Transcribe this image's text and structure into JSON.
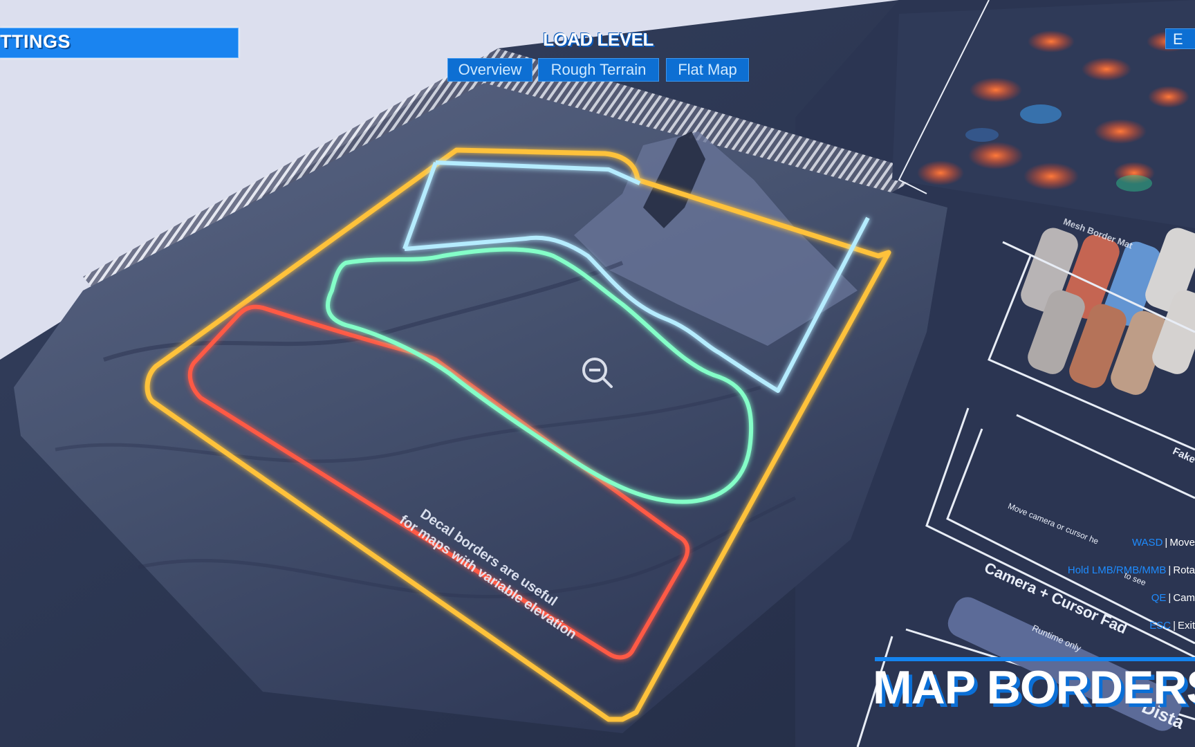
{
  "settings_menu": {
    "label": "TTINGS"
  },
  "load_level": {
    "title": "LOAD LEVEL",
    "buttons": [
      {
        "label": "Overview"
      },
      {
        "label": "Rough Terrain"
      },
      {
        "label": "Flat Map"
      }
    ]
  },
  "exit_button": {
    "label": "E"
  },
  "terrain": {
    "caption_line1": "Decal borders are useful",
    "caption_line2": "for maps with variable elevation",
    "borders": [
      {
        "name": "orange-border",
        "color": "#ffb020"
      },
      {
        "name": "red-border",
        "color": "#ff5540"
      },
      {
        "name": "green-border",
        "color": "#7dffc0"
      },
      {
        "name": "blue-border",
        "color": "#a9e6ff"
      }
    ]
  },
  "floor_labels": {
    "mesh_border": "Mesh Border Mat",
    "fake": "Fake",
    "move_hint": "Move camera or cursor he",
    "see_hint": "to see",
    "camera_cursor": "Camera + Cursor Fad",
    "runtime": "Runtime only",
    "distance": "Dista"
  },
  "controls": [
    {
      "key": "WASD",
      "action": "Move"
    },
    {
      "key": "Hold LMB/RMB/MMB",
      "action": "Rota"
    },
    {
      "key": "QE",
      "action": "Cam"
    },
    {
      "key": "ESC",
      "action": "Exit"
    }
  ],
  "showcase_title": "MAP BORDERS",
  "colors": {
    "accent": "#1a84f0",
    "floor": "#2a3550",
    "sky": "#dcdfee"
  }
}
